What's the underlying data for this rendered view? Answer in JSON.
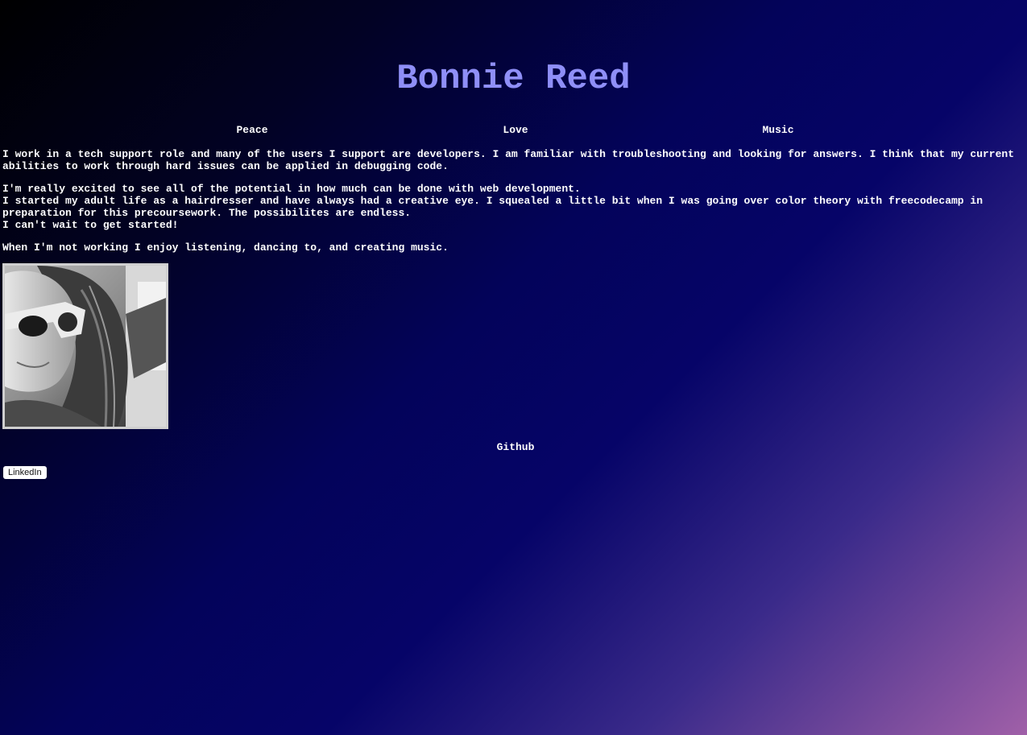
{
  "header": {
    "title": "Bonnie Reed"
  },
  "nav": {
    "items": [
      "Peace",
      "Love",
      "Music"
    ]
  },
  "about": {
    "paragraph1": [
      "I work in a tech support role and many of the users I support are developers. I am familiar with troubleshooting and looking for answers. I think that my current",
      "abilities to work through hard issues can be applied in debugging code."
    ],
    "paragraph2": [
      "I'm really excited to see all of the potential in how much can be done with web development.",
      "I started my adult life as a hairdresser and have always had a creative eye. I squealed a little bit when I was going over color theory with freecodecamp in",
      "preparation for this precoursework. The possibilites are endless.",
      "I can't wait to get started!"
    ],
    "paragraph3": "When I'm not working I enjoy listening, dancing to, and creating music."
  },
  "links": {
    "github_label": "Github",
    "linkedin_label": "LinkedIn"
  },
  "colors": {
    "title": "#8f8ff7",
    "text": "#ffffff",
    "background_start": "#000000",
    "background_mid": "#03035a",
    "background_end": "#a060a8"
  }
}
